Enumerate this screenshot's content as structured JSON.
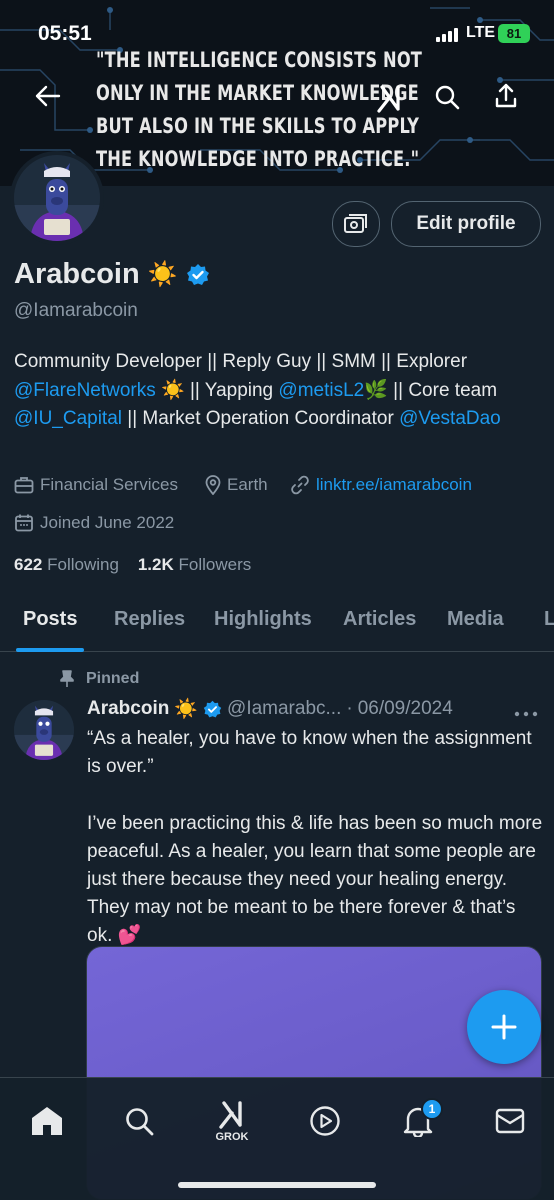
{
  "status": {
    "time": "05:51",
    "network": "LTE",
    "battery": "81"
  },
  "banner": {
    "quote": "\"The intelligence consists not only in the market knowledge but also in the skills to apply the knowledge into practice.\""
  },
  "profile": {
    "name": "Arabcoin",
    "name_emoji": "☀️",
    "handle": "@Iamarabcoin",
    "edit_label": "Edit profile",
    "bio": {
      "line1": "Community Developer || Reply Guy || SMM || Explorer",
      "mention1": "@FlareNetworks",
      "sun": "☀️",
      "part2": " || Yapping ",
      "mention2": "@metisL2",
      "leaf": "🌿",
      "part3": " || Core team ",
      "mention3": "@IU_Capital",
      "part4": " || Market Operation Coordinator",
      "mention4": "@VestaDao"
    },
    "category": "Financial Services",
    "location": "Earth",
    "website": "linktr.ee/iamarabcoin",
    "joined": "Joined June 2022",
    "following_count": "622",
    "following_label": "Following",
    "followers_count": "1.2K",
    "followers_label": "Followers"
  },
  "tabs": [
    "Posts",
    "Replies",
    "Highlights",
    "Articles",
    "Media",
    "L"
  ],
  "pinned_post": {
    "pinned_label": "Pinned",
    "name": "Arabcoin",
    "name_emoji": "☀️",
    "handle": "@Iamarabc...",
    "separator": "·",
    "date": "06/09/2024",
    "text": "“As a healer, you have to know when the assignment is over.”\n\nI’ve been practicing this & life has been so much more peaceful. As a healer, you learn that some people are just there because they need your healing energy. They may not be meant to be there forever & that’s ok. 💕"
  },
  "bottom_nav": {
    "grok_label": "GROK",
    "notifications_badge": "1"
  },
  "colors": {
    "background": "#15202b",
    "accent": "#1d9bf0",
    "secondary_text": "#8b98a5"
  }
}
